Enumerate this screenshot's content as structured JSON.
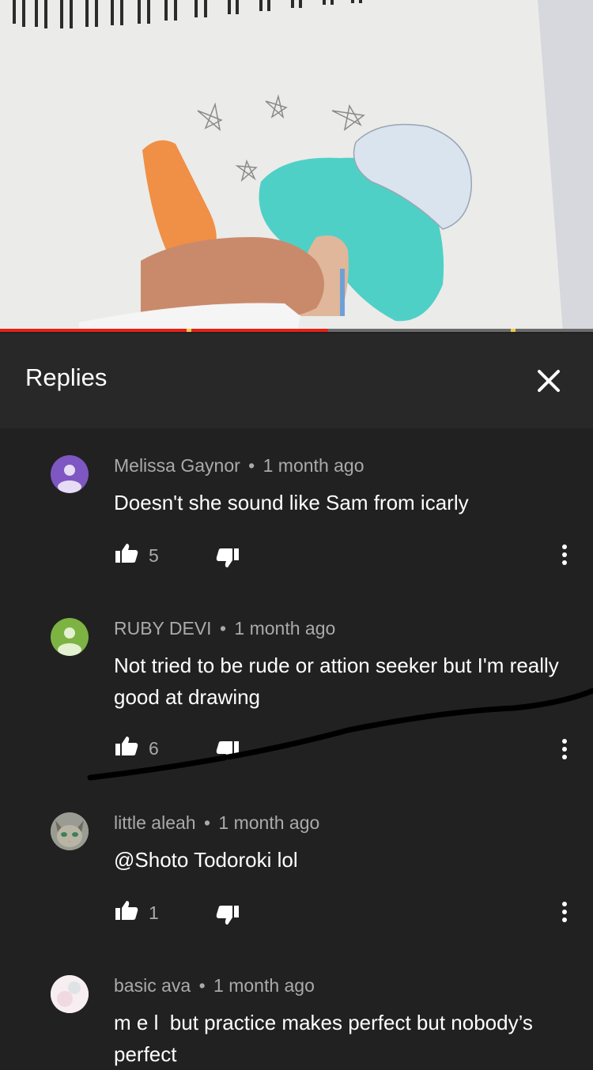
{
  "replies_panel": {
    "title": "Replies",
    "close_icon": "close-icon"
  },
  "comments": [
    {
      "author": "Melissa Gaynor",
      "separator": "•",
      "time": "1 month ago",
      "text": "Doesn't she sound like Sam from icarly",
      "likes": "5",
      "avatar_color": "#7e57c2"
    },
    {
      "author": "RUBY DEVI",
      "separator": "•",
      "time": "1 month ago",
      "text": "Not tried to be rude or attion seeker but I'm really good at drawing",
      "likes": "6",
      "avatar_color": "#7cb342"
    },
    {
      "author": "little aleah",
      "separator": "•",
      "time": "1 month ago",
      "text": "@Shoto Todoroki lol",
      "likes": "1",
      "avatar_color": "#8d8f88"
    },
    {
      "author": "basic ava",
      "separator": "•",
      "time": "1 month ago",
      "text": "m e l  but practice makes perfect but nobody’s perfect",
      "avatar_color": "#f3e6ea"
    }
  ],
  "video": {
    "progress_fraction": 0.553
  },
  "colors": {
    "background": "#212121",
    "header": "#282828",
    "progress": "#e62117",
    "secondary_text": "#aaaaaa"
  }
}
